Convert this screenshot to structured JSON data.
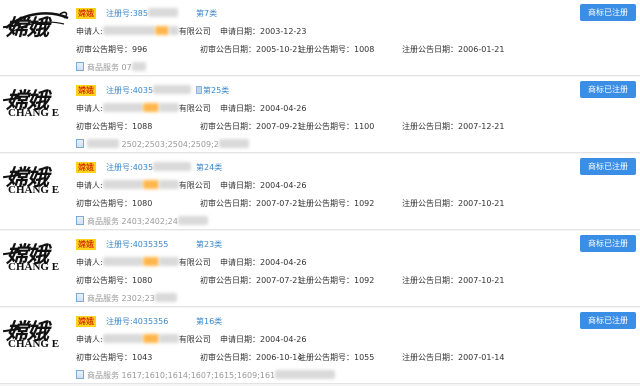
{
  "cards": [
    {
      "logo_cn": "嫦娥",
      "logo_en": "",
      "logo_style": "swirl",
      "tag": "嫦娥",
      "reg_no": "注册号:385",
      "class_label": "第7类",
      "applicant_label": "申请人:",
      "applicant_suffix": "有限公司",
      "apply_date": "申请日期：2003-12-23",
      "first_issue": "初审公告期号：996",
      "first_date": "初审公告日期：2005-10-21",
      "reg_issue": "注册公告期号：1008",
      "reg_date": "注册公告日期：2006-01-21",
      "goods_label": "商品服务",
      "goods_value": "07",
      "status_button": "商标已注册"
    },
    {
      "logo_cn": "嫦娥",
      "logo_en": "CHANG E",
      "logo_style": "plain",
      "tag": "嫦娥",
      "reg_no": "注册号:4035",
      "class_label": "第25类",
      "applicant_label": "申请人:",
      "applicant_suffix": "有限公司",
      "apply_date": "申请日期：2004-04-26",
      "first_issue": "初审公告期号：1088",
      "first_date": "初审公告日期：2007-09-21",
      "reg_issue": "注册公告期号：1100",
      "reg_date": "注册公告日期：2007-12-21",
      "goods_label": "",
      "goods_value": "2502;2503;2504;2509;2",
      "status_button": "商标已注册"
    },
    {
      "logo_cn": "嫦娥",
      "logo_en": "CHANG E",
      "logo_style": "plain",
      "tag": "嫦娥",
      "reg_no": "注册号:4035",
      "class_label": "第24类",
      "applicant_label": "申请人:",
      "applicant_suffix": "有限公司",
      "apply_date": "申请日期：2004-04-26",
      "first_issue": "初审公告期号：1080",
      "first_date": "初审公告日期：2007-07-21",
      "reg_issue": "注册公告期号：1092",
      "reg_date": "注册公告日期：2007-10-21",
      "goods_label": "商品服务",
      "goods_value": "2403;2402;24",
      "status_button": "商标已注册"
    },
    {
      "logo_cn": "嫦娥",
      "logo_en": "CHANG E",
      "logo_style": "plain",
      "tag": "嫦娥",
      "reg_no": "注册号:4035355",
      "class_label": "第23类",
      "applicant_label": "申请人:",
      "applicant_suffix": "有限公司",
      "apply_date": "申请日期：2004-04-26",
      "first_issue": "初审公告期号：1080",
      "first_date": "初审公告日期：2007-07-21",
      "reg_issue": "注册公告期号：1092",
      "reg_date": "注册公告日期：2007-10-21",
      "goods_label": "商品服务",
      "goods_value": "2302;23",
      "status_button": "商标已注册"
    },
    {
      "logo_cn": "嫦娥",
      "logo_en": "CHANG E",
      "logo_style": "plain",
      "tag": "嫦娥",
      "reg_no": "注册号:4035356",
      "class_label": "第16类",
      "applicant_label": "申请人:",
      "applicant_suffix": "有限公司",
      "apply_date": "申请日期：2004-04-26",
      "first_issue": "初审公告期号：1043",
      "first_date": "初审公告日期：2006-10-14",
      "reg_issue": "注册公告期号：1055",
      "reg_date": "注册公告日期：2007-01-14",
      "goods_label": "商品服务",
      "goods_value": "1617;1610;1614;1607;1615;1609;161",
      "status_button": "商标已注册"
    }
  ],
  "colors": {
    "link": "#3a87c8",
    "button": "#3a8ee6",
    "tag_bg": "#ffd31a",
    "tag_fg": "#cc0000"
  }
}
